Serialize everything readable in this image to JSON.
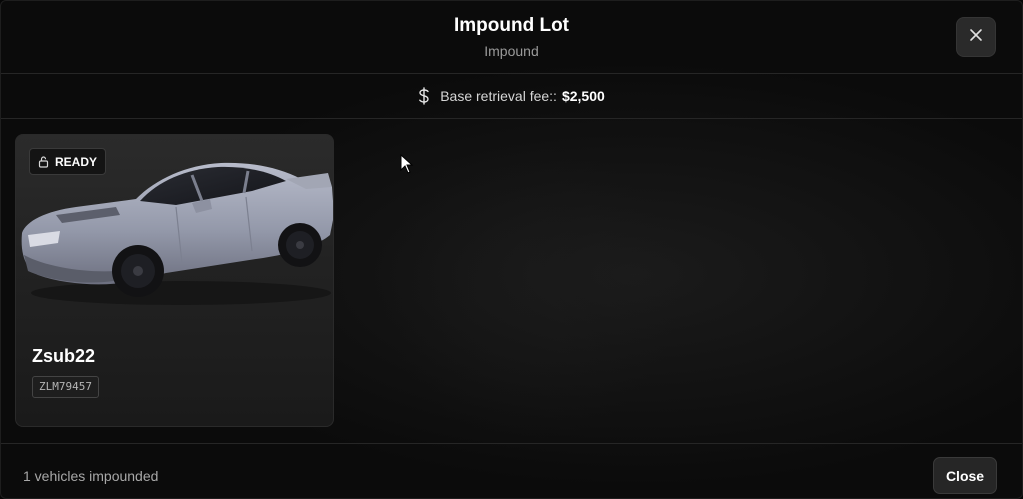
{
  "header": {
    "title": "Impound Lot",
    "subtitle": "Impound"
  },
  "fee": {
    "label": "Base retrieval fee::",
    "amount": "$2,500",
    "icon": "dollar-icon"
  },
  "vehicles": [
    {
      "status": "READY",
      "status_icon": "lock-icon",
      "name": "Zsub22",
      "plate": "ZLM79457",
      "color": "#9ea3b5"
    }
  ],
  "footer": {
    "count_text": "1 vehicles impounded",
    "close_label": "Close"
  },
  "colors": {
    "background": "#0b0b0b",
    "card": "#2b2b2b",
    "border": "#262626",
    "text": "#ffffff",
    "muted": "#9a9a9a"
  }
}
